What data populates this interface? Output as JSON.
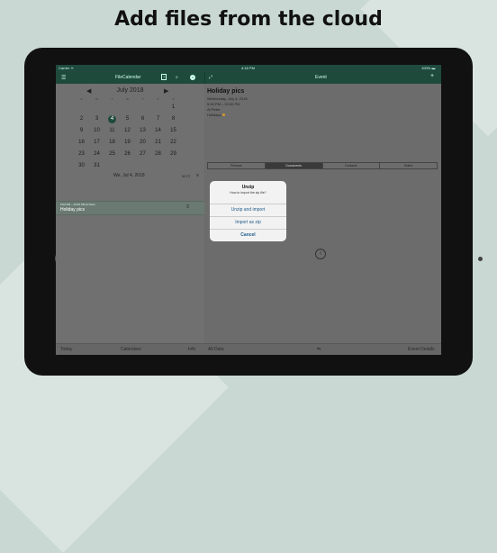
{
  "headline": "Add files from the cloud",
  "status": {
    "carrier": "Carrier ᯤ",
    "time": "4:18 PM",
    "battery": "100% ▬"
  },
  "nav": {
    "left_title": "FileCalendar",
    "right_title": "Event",
    "today_icon_label": "7"
  },
  "calendar": {
    "month": "July 2018",
    "dow": [
      "S",
      "M",
      "T",
      "W",
      "T",
      "F",
      "S"
    ],
    "weeks": [
      [
        "",
        "",
        "",
        "",
        "",
        "",
        "1"
      ],
      [
        "2",
        "3",
        "4",
        "5",
        "6",
        "7",
        "8"
      ],
      [
        "9",
        "10",
        "11",
        "12",
        "13",
        "14",
        "15"
      ],
      [
        "16",
        "17",
        "18",
        "19",
        "20",
        "21",
        "22"
      ],
      [
        "23",
        "24",
        "25",
        "26",
        "27",
        "28",
        "29"
      ],
      [
        "30",
        "31",
        "",
        "",
        "",
        "",
        ""
      ]
    ],
    "today": "4",
    "date_line": "We, Jul 4, 2018",
    "week_num": "W 27"
  },
  "event_row": {
    "meta": "9:00 PM – 10:00 PM At Peter",
    "title": "Holiday pics",
    "count": "3"
  },
  "event": {
    "title": "Holiday pics",
    "date": "Wednesday, July 4, 2018",
    "time": "9:00 PM – 10:00 PM",
    "location": "At Peter",
    "calendar": "Holidays"
  },
  "segments": [
    "Pictures",
    "Documents",
    "Contacts",
    "Notes"
  ],
  "active_segment": 1,
  "alert": {
    "title": "Unzip",
    "message": "How to import the zip file?",
    "buttons": [
      "Unzip and import",
      "Import as zip",
      "Cancel"
    ]
  },
  "toolbar": {
    "today": "Today",
    "calendars": "Calendars",
    "info": "Info",
    "all_data": "All Data",
    "event_details": "Event Details"
  },
  "colors": {
    "nav_green": "#1e4a3c",
    "accent_dot": "#d49a2a",
    "alert_button": "#1f5b8a"
  }
}
